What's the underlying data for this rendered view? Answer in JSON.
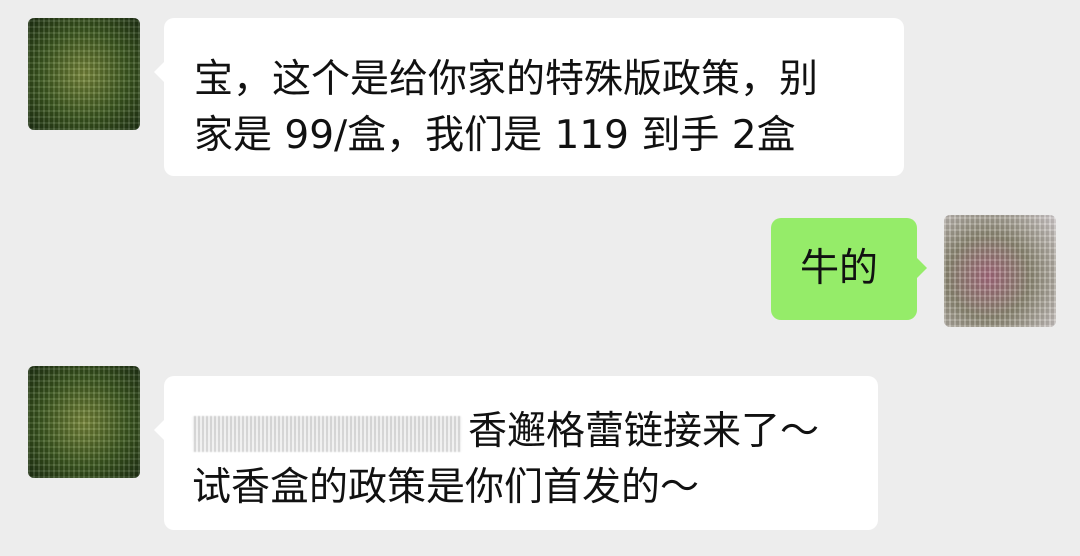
{
  "messages": [
    {
      "side": "left",
      "lines": [
        "宝，这个是给你家的特殊版政策，别",
        "家是 99/盒，我们是 119 到手 2盒"
      ]
    },
    {
      "side": "right",
      "lines": [
        "牛的"
      ]
    },
    {
      "side": "left",
      "lines": [
        "香邂格蕾链接来了～",
        "试香盒的政策是你们首发的～"
      ]
    }
  ]
}
